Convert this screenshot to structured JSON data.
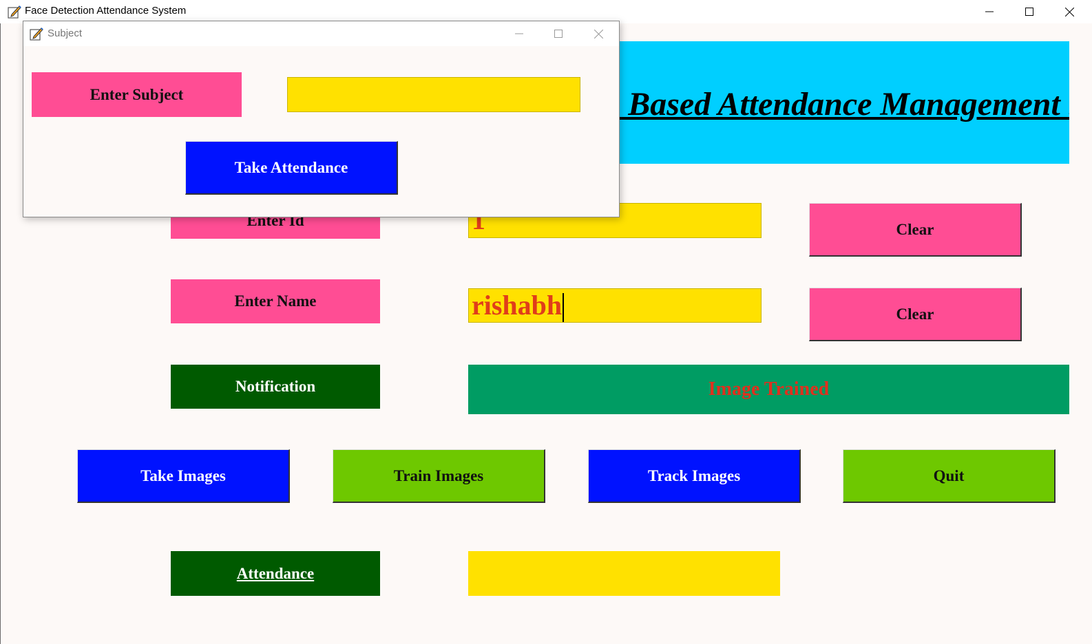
{
  "window": {
    "title": "Face Detection Attendance System"
  },
  "banner": {
    "title": "Face Recognition Based Attendance Management System"
  },
  "form": {
    "enter_id_label": "Enter Id",
    "id_value": "1",
    "enter_name_label": "Enter Name",
    "name_value": "rishabh",
    "clear_label": "Clear",
    "notification_label": "Notification",
    "notification_message": "Image Trained"
  },
  "actions": {
    "take_images": "Take Images",
    "train_images": "Train Images",
    "track_images": "Track Images",
    "quit": "Quit"
  },
  "attendance": {
    "label": "Attendance",
    "value": ""
  },
  "subject_dialog": {
    "title": "Subject",
    "enter_subject_label": "Enter Subject",
    "subject_value": "",
    "take_attendance_label": "Take Attendance"
  },
  "colors": {
    "background": "#fdf9f7",
    "banner": "#00cfff",
    "pink": "#ff4d94",
    "yellow": "#ffe100",
    "dark_green": "#005a00",
    "teal_green": "#009c63",
    "blue": "#0012ff",
    "lime": "#6ec800",
    "entry_text": "#e03d1a"
  },
  "icons": {
    "app": "pen-paper-icon",
    "minimize": "minimize-icon",
    "maximize": "maximize-icon",
    "close": "close-icon"
  }
}
